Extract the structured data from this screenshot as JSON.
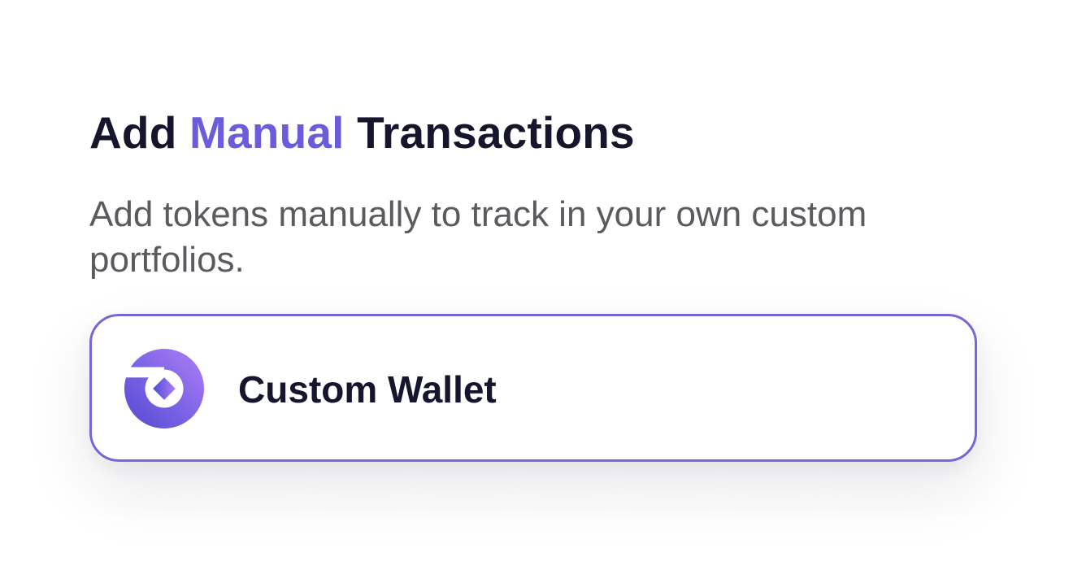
{
  "heading": {
    "part1": "Add ",
    "accent": "Manual",
    "part2": " Transactions"
  },
  "description": "Add tokens manually to track in your own custom portfolios.",
  "wallet_option": {
    "label": "Custom Wallet",
    "icon": "custom-wallet-logo-icon"
  },
  "colors": {
    "accent": "#6b5cdc",
    "card_border": "#7666d8",
    "heading": "#15152e",
    "description": "#5a5a5f",
    "icon_gradient_start": "#a77bf3",
    "icon_gradient_end": "#5b4fd6"
  }
}
